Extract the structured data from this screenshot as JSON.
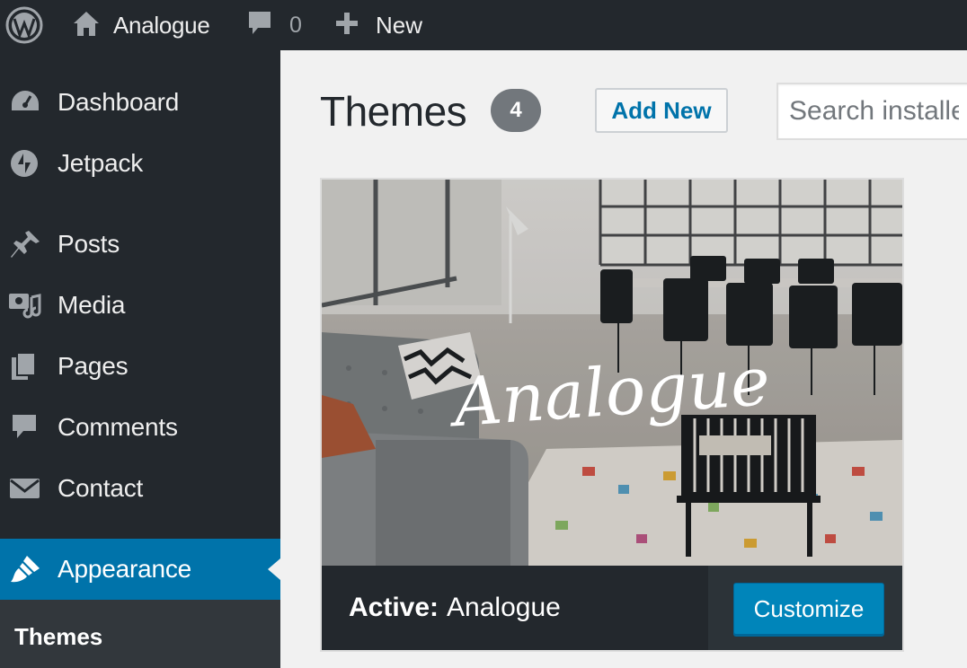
{
  "admin_bar": {
    "site_name": "Analogue",
    "comments_count": "0",
    "new_label": "New"
  },
  "sidebar": {
    "items": [
      {
        "label": "Dashboard",
        "icon": "dashboard-icon"
      },
      {
        "label": "Jetpack",
        "icon": "jetpack-icon"
      },
      {
        "label": "Posts",
        "icon": "pin-icon"
      },
      {
        "label": "Media",
        "icon": "media-icon"
      },
      {
        "label": "Pages",
        "icon": "pages-icon"
      },
      {
        "label": "Comments",
        "icon": "comment-icon"
      },
      {
        "label": "Contact",
        "icon": "envelope-icon"
      },
      {
        "label": "Appearance",
        "icon": "brush-icon",
        "current": true
      }
    ],
    "submenu": {
      "current": "Themes"
    }
  },
  "main": {
    "title": "Themes",
    "count": "4",
    "add_new_label": "Add New",
    "search_placeholder": "Search installed themes..."
  },
  "theme": {
    "screenshot_logo": "Analogue",
    "active_label": "Active:",
    "name": "Analogue",
    "customize_label": "Customize"
  },
  "colors": {
    "admin_bg": "#23282d",
    "accent": "#0073aa",
    "button_primary": "#0085ba",
    "page_bg": "#f1f1f1"
  }
}
